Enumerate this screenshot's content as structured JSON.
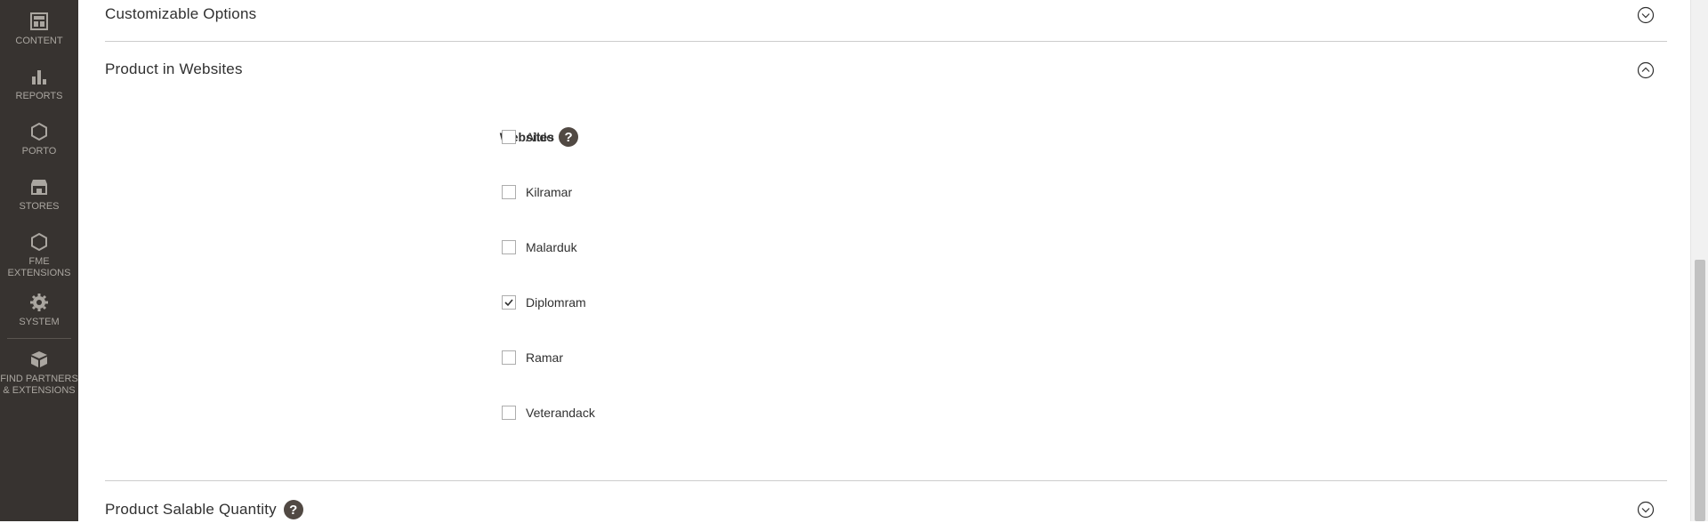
{
  "sidebar": {
    "items": [
      {
        "label": "CONTENT",
        "icon": "content-icon"
      },
      {
        "label": "REPORTS",
        "icon": "reports-icon"
      },
      {
        "label": "PORTO",
        "icon": "hexagon-icon"
      },
      {
        "label": "STORES",
        "icon": "stores-icon"
      },
      {
        "label_line1": "FME",
        "label_line2": "EXTENSIONS",
        "icon": "hexagon-icon"
      },
      {
        "label": "SYSTEM",
        "icon": "gear-icon"
      },
      {
        "label_line1": "FIND PARTNERS",
        "label_line2": "& EXTENSIONS",
        "icon": "box-icon"
      }
    ]
  },
  "sections": {
    "customizable_options": {
      "title": "Customizable Options",
      "state": "collapsed"
    },
    "product_in_websites": {
      "title": "Product in Websites",
      "state": "expanded",
      "field_label": "Websites",
      "options": [
        {
          "label": "Alldo",
          "checked": false
        },
        {
          "label": "Kilramar",
          "checked": false
        },
        {
          "label": "Malarduk",
          "checked": false
        },
        {
          "label": "Diplomram",
          "checked": true
        },
        {
          "label": "Ramar",
          "checked": false
        },
        {
          "label": "Veterandack",
          "checked": false
        }
      ],
      "help_glyph": "?"
    },
    "product_salable_quantity": {
      "title": "Product Salable Quantity",
      "state": "collapsed",
      "help_glyph": "?"
    }
  },
  "colors": {
    "sidebar_bg": "#373330",
    "sidebar_text": "#aaa6a0",
    "help_bg": "#514943"
  }
}
